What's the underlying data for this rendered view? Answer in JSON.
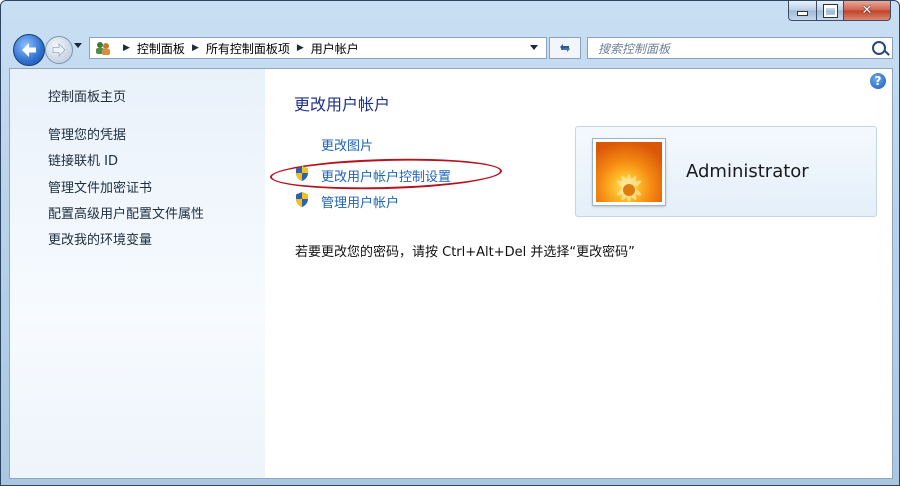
{
  "breadcrumb": [
    "控制面板",
    "所有控制面板项",
    "用户帐户"
  ],
  "search": {
    "placeholder": "搜索控制面板"
  },
  "sidebar": {
    "items": [
      {
        "label": "控制面板主页"
      },
      {
        "label": "管理您的凭据"
      },
      {
        "label": "链接联机 ID"
      },
      {
        "label": "管理文件加密证书"
      },
      {
        "label": "配置高级用户配置文件属性"
      },
      {
        "label": "更改我的环境变量"
      }
    ]
  },
  "main": {
    "title": "更改用户帐户",
    "tasks": [
      {
        "label": "更改图片",
        "icon": null
      },
      {
        "label": "更改用户帐户控制设置",
        "icon": "uac-shield-icon",
        "highlighted": true
      },
      {
        "label": "管理用户帐户",
        "icon": "uac-shield-icon"
      }
    ],
    "password_hint": "若要更改您的密码，请按 Ctrl+Alt+Del 并选择“更改密码”"
  },
  "user": {
    "name": "Administrator"
  },
  "colors": {
    "link": "#1e63b6",
    "title": "#1e3287",
    "highlight_ellipse": "#b8121e",
    "sidebar_bg": "#eef4fb"
  }
}
